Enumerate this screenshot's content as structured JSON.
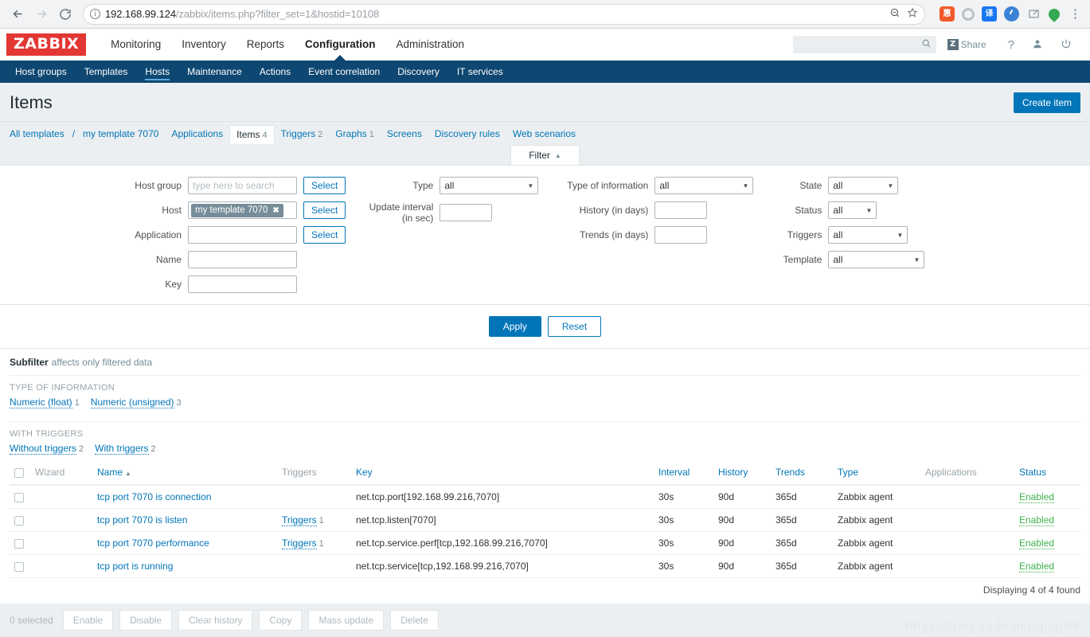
{
  "browser": {
    "back_icon": "back-arrow-icon",
    "forward_icon": "forward-arrow-icon",
    "reload_icon": "reload-icon",
    "url_host": "192.168.99.124",
    "url_path": "/zabbix/items.php?filter_set=1&hostid=10108",
    "url_full": "192.168.99.124/zabbix/items.php?filter_set=1&hostid=10108",
    "zoom_icon": "zoom-out-icon",
    "bookmark_icon": "star-icon",
    "extensions": [
      "hui-extension-icon",
      "ring-extension-icon",
      "translate-extension-icon",
      "clock-extension-icon",
      "pen-extension-icon",
      "location-extension-icon"
    ],
    "menu_icon": "kebab-menu-icon"
  },
  "header": {
    "logo": "ZABBIX",
    "nav": [
      {
        "label": "Monitoring",
        "selected": false
      },
      {
        "label": "Inventory",
        "selected": false
      },
      {
        "label": "Reports",
        "selected": false
      },
      {
        "label": "Configuration",
        "selected": true
      },
      {
        "label": "Administration",
        "selected": false
      }
    ],
    "search_value": "",
    "search_placeholder": "",
    "search_icon": "search-icon",
    "share_label": "Share",
    "share_badge": "Z",
    "help_icon": "question-mark-icon",
    "user_icon": "user-icon",
    "logout_icon": "power-icon"
  },
  "subnav": [
    {
      "label": "Host groups",
      "selected": false
    },
    {
      "label": "Templates",
      "selected": false
    },
    {
      "label": "Hosts",
      "selected": true
    },
    {
      "label": "Maintenance",
      "selected": false
    },
    {
      "label": "Actions",
      "selected": false
    },
    {
      "label": "Event correlation",
      "selected": false
    },
    {
      "label": "Discovery",
      "selected": false
    },
    {
      "label": "IT services",
      "selected": false
    }
  ],
  "page": {
    "title": "Items",
    "create_button": "Create item"
  },
  "breadcrumb": {
    "all_templates": "All templates",
    "separator": "/",
    "template": "my template 7070",
    "tabs": [
      {
        "label": "Applications",
        "count": "",
        "selected": false
      },
      {
        "label": "Items",
        "count": "4",
        "selected": true
      },
      {
        "label": "Triggers",
        "count": "2",
        "selected": false
      },
      {
        "label": "Graphs",
        "count": "1",
        "selected": false
      },
      {
        "label": "Screens",
        "count": "",
        "selected": false
      },
      {
        "label": "Discovery rules",
        "count": "",
        "selected": false
      },
      {
        "label": "Web scenarios",
        "count": "",
        "selected": false
      }
    ]
  },
  "filter": {
    "tab_label": "Filter",
    "tab_caret": "▲",
    "col1": {
      "host_group_label": "Host group",
      "host_group_value": "",
      "host_group_placeholder": "type here to search",
      "host_group_select": "Select",
      "host_label": "Host",
      "host_token": "my template 7070",
      "host_token_remove": "✖",
      "host_select": "Select",
      "application_label": "Application",
      "application_value": "",
      "application_select": "Select",
      "name_label": "Name",
      "name_value": "",
      "key_label": "Key",
      "key_value": ""
    },
    "col2": {
      "type_label": "Type",
      "type_value": "all",
      "update_interval_label": "Update interval (in sec)",
      "update_interval_value": ""
    },
    "col3": {
      "type_of_information_label": "Type of information",
      "type_of_information_value": "all",
      "history_label": "History (in days)",
      "history_value": "",
      "trends_label": "Trends (in days)",
      "trends_value": ""
    },
    "col4": {
      "state_label": "State",
      "state_value": "all",
      "status_label": "Status",
      "status_value": "all",
      "triggers_label": "Triggers",
      "triggers_value": "all",
      "template_label": "Template",
      "template_value": "all"
    },
    "apply_label": "Apply",
    "reset_label": "Reset"
  },
  "subfilter": {
    "title": "Subfilter",
    "hint": "affects only filtered data",
    "groups": [
      {
        "heading": "TYPE OF INFORMATION",
        "items": [
          {
            "label": "Numeric (float)",
            "count": "1"
          },
          {
            "label": "Numeric (unsigned)",
            "count": "3"
          }
        ]
      },
      {
        "heading": "WITH TRIGGERS",
        "items": [
          {
            "label": "Without triggers",
            "count": "2"
          },
          {
            "label": "With triggers",
            "count": "2"
          }
        ]
      }
    ]
  },
  "table": {
    "columns": [
      "Wizard",
      "Name",
      "Triggers",
      "Key",
      "Interval",
      "History",
      "Trends",
      "Type",
      "Applications",
      "Status"
    ],
    "sort_column": "Name",
    "sort_arrow": "▲",
    "rows": [
      {
        "name": "tcp port 7070 is connection",
        "triggers_label": "",
        "triggers_count": "",
        "key": "net.tcp.port[192.168.99.216,7070]",
        "interval": "30s",
        "history": "90d",
        "trends": "365d",
        "type": "Zabbix agent",
        "applications": "",
        "status": "Enabled"
      },
      {
        "name": "tcp port 7070 is listen",
        "triggers_label": "Triggers",
        "triggers_count": "1",
        "key": "net.tcp.listen[7070]",
        "interval": "30s",
        "history": "90d",
        "trends": "365d",
        "type": "Zabbix agent",
        "applications": "",
        "status": "Enabled"
      },
      {
        "name": "tcp port 7070 performance",
        "triggers_label": "Triggers",
        "triggers_count": "1",
        "key": "net.tcp.service.perf[tcp,192.168.99.216,7070]",
        "interval": "30s",
        "history": "90d",
        "trends": "365d",
        "type": "Zabbix agent",
        "applications": "",
        "status": "Enabled"
      },
      {
        "name": "tcp port is running",
        "triggers_label": "",
        "triggers_count": "",
        "key": "net.tcp.service[tcp,192.168.99.216,7070]",
        "interval": "30s",
        "history": "90d",
        "trends": "365d",
        "type": "Zabbix agent",
        "applications": "",
        "status": "Enabled"
      }
    ],
    "displaying": "Displaying 4 of 4 found"
  },
  "footer": {
    "selected_count": "0 selected",
    "buttons": [
      "Enable",
      "Disable",
      "Clear history",
      "Copy",
      "Mass update",
      "Delete"
    ]
  },
  "watermark": "https://blog.csdn.net/quqi99",
  "colors": {
    "brand_red": "#e33734",
    "nav_dark": "#0e4771",
    "link_blue": "#0275b8",
    "enabled_green": "#3db24b",
    "page_bg": "#eceff1"
  }
}
